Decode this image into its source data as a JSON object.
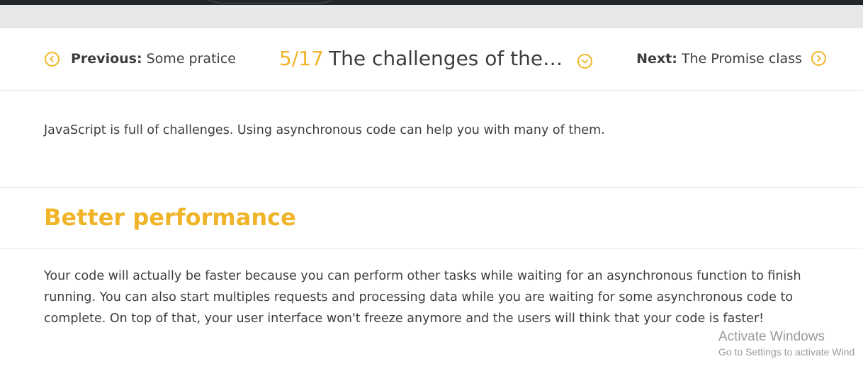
{
  "nav": {
    "previous": {
      "label": "Previous:",
      "title": "Some pratice",
      "icon": "chevron-left-circle-icon"
    },
    "current": {
      "number": "5/17",
      "title": "The challenges of the asynchronous code",
      "icon": "chevron-down-circle-icon"
    },
    "next": {
      "label": "Next:",
      "title": "The Promise class",
      "icon": "chevron-right-circle-icon"
    }
  },
  "content": {
    "intro": "JavaScript is full of challenges. Using asynchronous code can help you with many of them.",
    "section_heading": "Better performance",
    "paragraph": "Your code will actually be faster because you can perform other tasks while waiting for an asynchronous function to finish running. You can also start multiples requests and processing data while you are waiting for some asynchronous code to complete. On top of that, your user interface won't freeze anymore and the users will think that your code is faster!"
  },
  "watermark": {
    "title": "Activate Windows",
    "subtitle": "Go to Settings to activate Wind"
  },
  "colors": {
    "accent": "#f0b429",
    "text": "#3d3d3d",
    "topbar": "#23262b",
    "strip": "#e8e8ea",
    "divider": "#e6e6e6"
  }
}
